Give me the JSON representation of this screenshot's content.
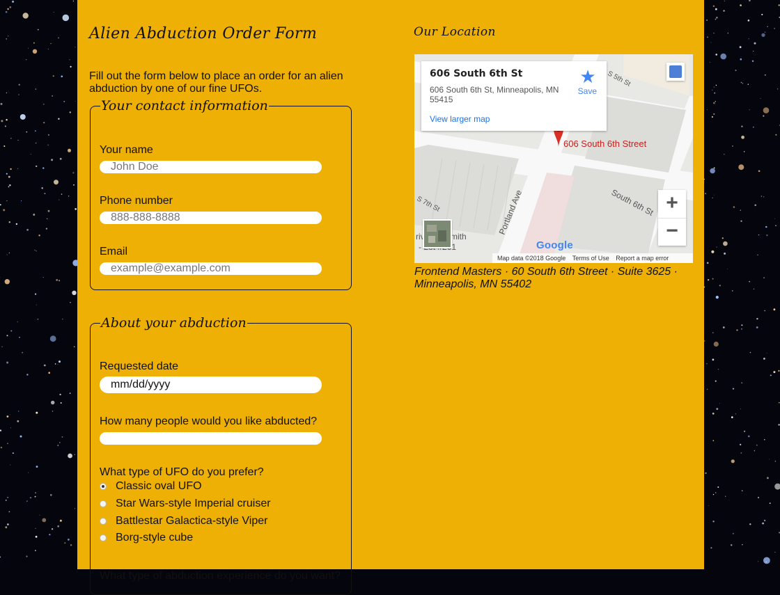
{
  "form": {
    "title": "Alien Abduction Order Form",
    "intro": "Fill out the form below to place an order for an alien abduction by one of our fine UFOs.",
    "contact": {
      "legend": "Your contact information",
      "name_label": "Your name",
      "name_placeholder": "John Doe",
      "phone_label": "Phone number",
      "phone_placeholder": "888-888-8888",
      "email_label": "Email",
      "email_placeholder": "example@example.com"
    },
    "abduction": {
      "legend": "About your abduction",
      "date_label": "Requested date",
      "date_value": "mm/dd/yyyy",
      "people_label": "How many people would you like abducted?",
      "ufo_label": "What type of UFO do you prefer?",
      "ufo_options": [
        {
          "label": "Classic oval UFO",
          "checked": true
        },
        {
          "label": "Star Wars-style Imperial cruiser",
          "checked": false
        },
        {
          "label": "Battlestar Galactica-style Viper",
          "checked": false
        },
        {
          "label": "Borg-style cube",
          "checked": false
        }
      ],
      "experience_label": "What type of abduction experience do you want?"
    }
  },
  "location": {
    "title": "Our Location",
    "map": {
      "place_name": "606 South 6th St",
      "place_address": "606 South 6th St, Minneapolis, MN 55415",
      "view_larger": "View larger map",
      "save_label": "Save",
      "pin_label": "606 South 6th Street",
      "zoom_in": "+",
      "zoom_out": "−",
      "google_logo": "Google",
      "footer_data": "Map data ©2018 Google",
      "footer_terms": "Terms of Use",
      "footer_report": "Report a map error",
      "street_south6th": "South 6th St",
      "street_portland": "Portland Ave",
      "street_s7th": "S 7th St",
      "street_s5th": "S 5th St",
      "poi_fragment1": "rivate",
      "poi_fragment2": "mith",
      "poi_fragment3": "- Lot #201"
    },
    "address": "Frontend Masters · 60 South 6th Street · Suite 3625 · Minneapolis, MN 55402"
  },
  "colors": {
    "page_bg": "#eeb004",
    "space_bg": "#05060d",
    "pin": "#d93025",
    "link": "#1a73e8"
  }
}
